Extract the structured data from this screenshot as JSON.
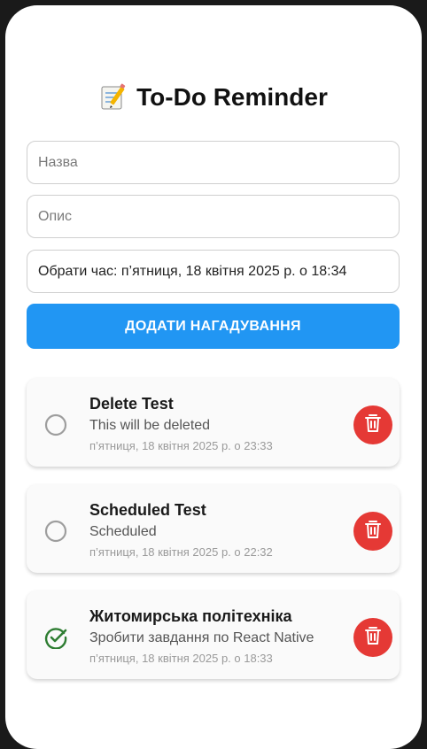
{
  "app": {
    "title": "To-Do Reminder",
    "title_icon": "memo-icon"
  },
  "form": {
    "title_placeholder": "Назва",
    "description_placeholder": "Опис",
    "time_picker_label": "Обрати час: п’ятниця, 18 квітня 2025 р. о 18:34",
    "add_button_label": "ДОДАТИ НАГАДУВАННЯ"
  },
  "colors": {
    "primary": "#2196f3",
    "danger": "#e53935",
    "done": "#2e7d32",
    "pending": "#9e9e9e"
  },
  "reminders": [
    {
      "title": "Delete Test",
      "description": "This will be deleted",
      "datetime": "п’ятниця, 18 квітня 2025 р. о 23:33",
      "completed": false
    },
    {
      "title": "Scheduled Test",
      "description": "Scheduled",
      "datetime": "п’ятниця, 18 квітня 2025 р. о 22:32",
      "completed": false
    },
    {
      "title": "Житомирська політехніка",
      "description": "Зробити завдання по React Native",
      "datetime": "п’ятниця, 18 квітня 2025 р. о 18:33",
      "completed": true
    }
  ]
}
